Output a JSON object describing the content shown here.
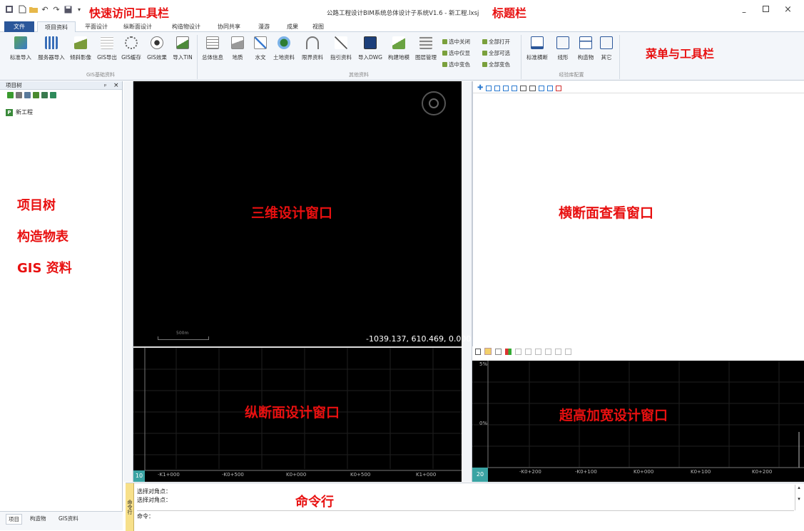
{
  "app": {
    "window_title": "公路工程设计BIM系统总体设计子系统V1.6 - 新工程.lxsj",
    "new_project": "新工程"
  },
  "annotations": {
    "quick_access": "快速访问工具栏",
    "title_bar": "标题栏",
    "menu_toolbar": "菜单与工具栏",
    "left_lines": [
      "项目树",
      "构造物表",
      "GIS 资料"
    ],
    "win_3d": "三维设计窗口",
    "win_cross": "横断面查看窗口",
    "win_profile": "纵断面设计窗口",
    "win_super": "超高加宽设计窗口",
    "cmd": "命令行"
  },
  "tabs": [
    "文件",
    "项目资料",
    "平面设计",
    "纵断面设计",
    "构造物设计",
    "协同共享",
    "漫游",
    "成果",
    "视图"
  ],
  "ribbon": {
    "gis_buttons": [
      "标准导入",
      "服务器导入",
      "倾斜影像",
      "GIS导出",
      "GIS缓存",
      "GIS效果",
      "导入TIN"
    ],
    "gis_group": "GIS基础资料",
    "other_buttons": [
      "总体信息",
      "地质",
      "水文",
      "土地资料",
      "限界资料",
      "指引资料",
      "导入DWG",
      "构建地模",
      "图层管理"
    ],
    "small_items": [
      [
        "选中关闭",
        "全部打开"
      ],
      [
        "选中仅显",
        "全部可选"
      ],
      [
        "选中变色",
        "全部变色"
      ]
    ],
    "other_group": "其他资料",
    "cfg_buttons": [
      "标准横断",
      "线形",
      "构造物",
      "其它"
    ],
    "cfg_group": "经验库配置"
  },
  "left_panel": {
    "title": "项目树",
    "pin": "ᵖ",
    "close": "×",
    "tree_item": "新工程",
    "bottom_tabs": [
      "项目",
      "构造物",
      "GIS资料"
    ]
  },
  "win3d": {
    "coords": "-1039.137, 610.469, 0.000",
    "scale_label": "500m"
  },
  "profile": {
    "ticks": [
      "-K1+000",
      "-K0+500",
      "K0+000",
      "K0+500",
      "K1+000"
    ],
    "corner": "10"
  },
  "superelev": {
    "ticks": [
      "-K0+200",
      "-K0+100",
      "K0+000",
      "K0+100",
      "K0+200"
    ],
    "y_top": "5%",
    "y_mid": "0%",
    "corner": "20"
  },
  "command": {
    "side_label": "命令行",
    "lines": [
      "选择对角点：",
      "选择对角点："
    ],
    "prompt": "命令："
  },
  "colors": {
    "accent": "#2b579a",
    "annotation_red": "#e81010",
    "window_bg": "#000000"
  }
}
